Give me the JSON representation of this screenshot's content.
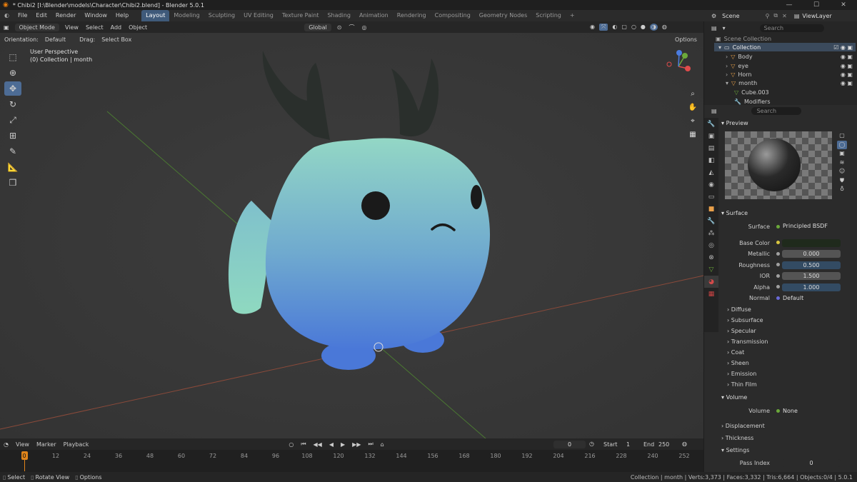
{
  "window": {
    "title": "* Chibi2 [I:\\Blender\\models\\Character\\Chibi2.blend] - Blender 5.0.1",
    "min": "—",
    "max": "☐",
    "close": "✕"
  },
  "menu": [
    "File",
    "Edit",
    "Render",
    "Window",
    "Help"
  ],
  "workspaces": [
    "Layout",
    "Modeling",
    "Sculpting",
    "UV Editing",
    "Texture Paint",
    "Shading",
    "Animation",
    "Rendering",
    "Compositing",
    "Geometry Nodes",
    "Scripting"
  ],
  "scene": {
    "label": "Scene",
    "viewlayer": "ViewLayer"
  },
  "viewport_header": {
    "mode": "Object Mode",
    "menus": [
      "View",
      "Select",
      "Add",
      "Object"
    ],
    "transform": "Global"
  },
  "tool_header": {
    "orientation_label": "Orientation:",
    "orientation": "Default",
    "drag_label": "Drag:",
    "drag": "Select Box",
    "options": "Options"
  },
  "viewport": {
    "perspective": "User Perspective",
    "collection_info": "(0) Collection | month"
  },
  "outliner": {
    "search_placeholder": "Search",
    "root": "Scene Collection",
    "collection": "Collection",
    "objects": [
      "Body",
      "eye",
      "Horn",
      "month"
    ],
    "children": [
      "Cube.003",
      "Modifiers"
    ]
  },
  "properties": {
    "search_placeholder": "Search",
    "preview_label": "Preview",
    "surface_section": "Surface",
    "surface_label": "Surface",
    "surface_value": "Principled BSDF",
    "base_color_label": "Base Color",
    "metallic_label": "Metallic",
    "metallic": "0.000",
    "roughness_label": "Roughness",
    "roughness": "0.500",
    "ior_label": "IOR",
    "ior": "1.500",
    "alpha_label": "Alpha",
    "alpha": "1.000",
    "normal_label": "Normal",
    "normal": "Default",
    "subsections": [
      "Diffuse",
      "Subsurface",
      "Specular",
      "Transmission",
      "Coat",
      "Sheen",
      "Emission",
      "Thin Film"
    ],
    "volume_section": "Volume",
    "volume_label": "Volume",
    "volume_value": "None",
    "displacement": "Displacement",
    "thickness": "Thickness",
    "settings": "Settings",
    "pass_index_label": "Pass Index",
    "pass_index": "0"
  },
  "timeline": {
    "menus": [
      "View",
      "Marker",
      "Playback"
    ],
    "current_frame": "0",
    "start_label": "Start",
    "start": "1",
    "end_label": "End",
    "end": "250",
    "ticks": [
      "0",
      "12",
      "24",
      "36",
      "48",
      "60",
      "72",
      "84",
      "96",
      "108",
      "120",
      "132",
      "144",
      "156",
      "168",
      "180",
      "192",
      "204",
      "216",
      "228",
      "240",
      "252"
    ]
  },
  "status": {
    "select": "Select",
    "rotate": "Rotate View",
    "options": "Options",
    "info": "Collection | month | Verts:3,373 | Faces:3,332 | Tris:6,664 | Objects:0/4 | 5.0.1"
  },
  "colors": {
    "accent": "#4d6c95",
    "body_top": "#8fd4c4",
    "body_bottom": "#4f7fd6",
    "horn": "#2a2f2c"
  }
}
